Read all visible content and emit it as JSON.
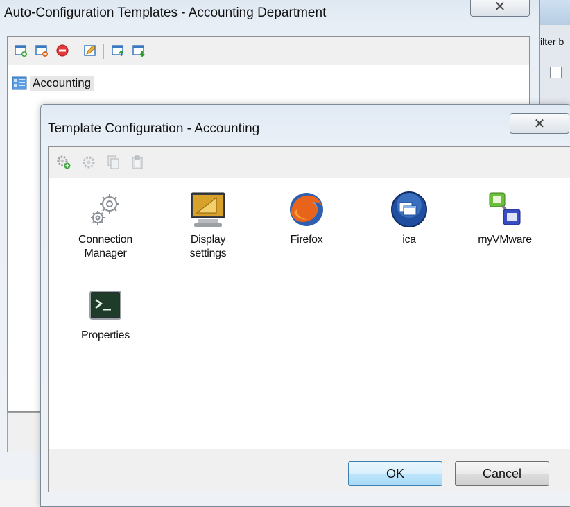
{
  "background_window": {
    "filter_label": "ilter b"
  },
  "outer_window": {
    "title": "Auto-Configuration Templates - Accounting Department",
    "close_glyph": "✕",
    "tree": {
      "node_label": "Accounting"
    }
  },
  "dialog": {
    "title": "Template Configuration - Accounting",
    "close_glyph": "✕",
    "items": [
      {
        "line1": "Connection",
        "line2": "Manager",
        "icon": "gears-icon"
      },
      {
        "line1": "Display",
        "line2": "settings",
        "icon": "display-icon"
      },
      {
        "line1": "Firefox",
        "line2": "",
        "icon": "firefox-icon"
      },
      {
        "line1": "ica",
        "line2": "",
        "icon": "ica-icon"
      },
      {
        "line1": "myVMware",
        "line2": "",
        "icon": "vmware-icon"
      },
      {
        "line1": "Properties",
        "line2": "",
        "icon": "terminal-icon"
      }
    ],
    "ok_label": "OK",
    "cancel_label": "Cancel"
  }
}
